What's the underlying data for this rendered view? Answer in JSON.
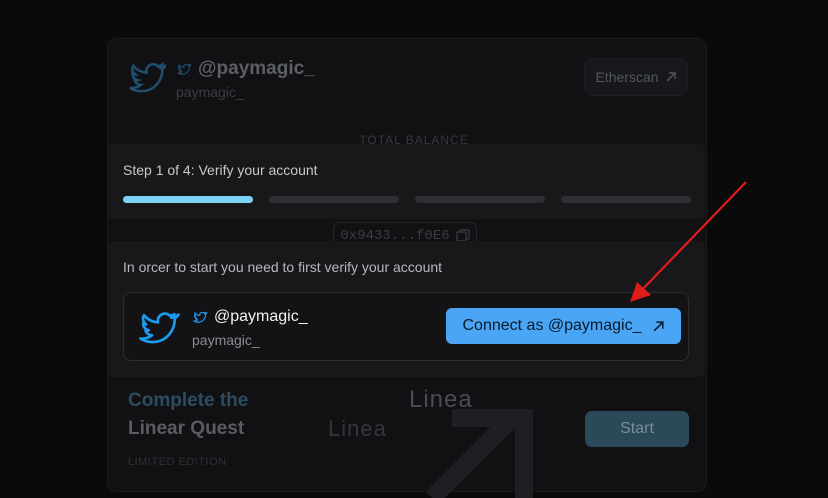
{
  "background": {
    "profile": {
      "handle": "@paymagic_",
      "username": "paymagic_"
    },
    "etherscan_label": "Etherscan",
    "total_balance_label": "TOTAL BALANCE",
    "address": "0x9433...f0E6",
    "quest": {
      "title_line1": "Complete the",
      "title_line2": "Linear Quest",
      "edition": "LIMITED EDITION",
      "brand": "Linea",
      "start_label": "Start"
    }
  },
  "step": {
    "label": "Step 1 of 4: Verify your account",
    "current": 1,
    "total": 4
  },
  "verify": {
    "instruction": "In orcer to start you need to first verify your account",
    "account": {
      "handle": "@paymagic_",
      "username": "paymagic_"
    },
    "connect_label": "Connect as @paymagic_"
  },
  "colors": {
    "accent": "#4aa6f4",
    "progress_active": "#7dd3f7",
    "twitter_blue": "#1d9bf0",
    "annotation_arrow": "#e01b1b"
  },
  "icons": [
    "twitter-bird-icon",
    "external-link-arrow-icon",
    "copy-icon"
  ]
}
